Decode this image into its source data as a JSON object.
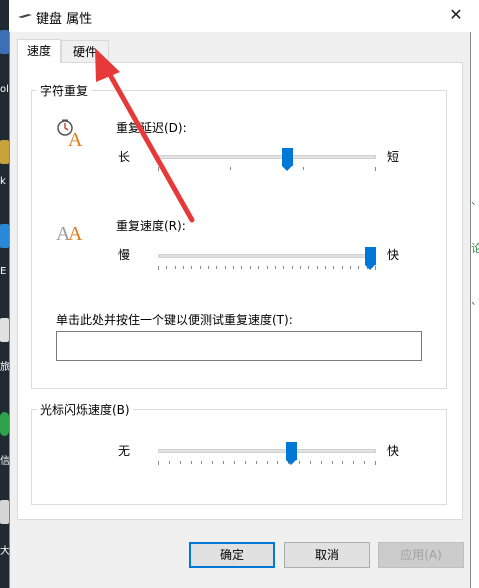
{
  "colors": {
    "accent": "#0078d7",
    "arrow": "#e8393a"
  },
  "window": {
    "title": "键盘 属性",
    "close_glyph": "✕"
  },
  "tabs": [
    {
      "label": "速度"
    },
    {
      "label": "硬件"
    }
  ],
  "char_repeat": {
    "group_label": "字符重复",
    "delay": {
      "label": "重复延迟(D):",
      "left": "长",
      "right": "短",
      "level": 0.6
    },
    "rate": {
      "label": "重复速度(R):",
      "left": "慢",
      "right": "快",
      "level": 1.0
    },
    "test": {
      "label": "单击此处并按住一个键以便测试重复速度(T):",
      "value": ""
    }
  },
  "cursor_blink": {
    "group_label": "光标闪烁速度(B)",
    "left": "无",
    "right": "快",
    "level": 0.62
  },
  "buttons": {
    "ok": "确定",
    "cancel": "取消",
    "apply": "应用(A)"
  },
  "desktop": {
    "left_labels": [
      "ol",
      "k",
      "E",
      "旅",
      "信",
      "大"
    ],
    "right_labels": [
      "、",
      "论",
      "、"
    ]
  }
}
